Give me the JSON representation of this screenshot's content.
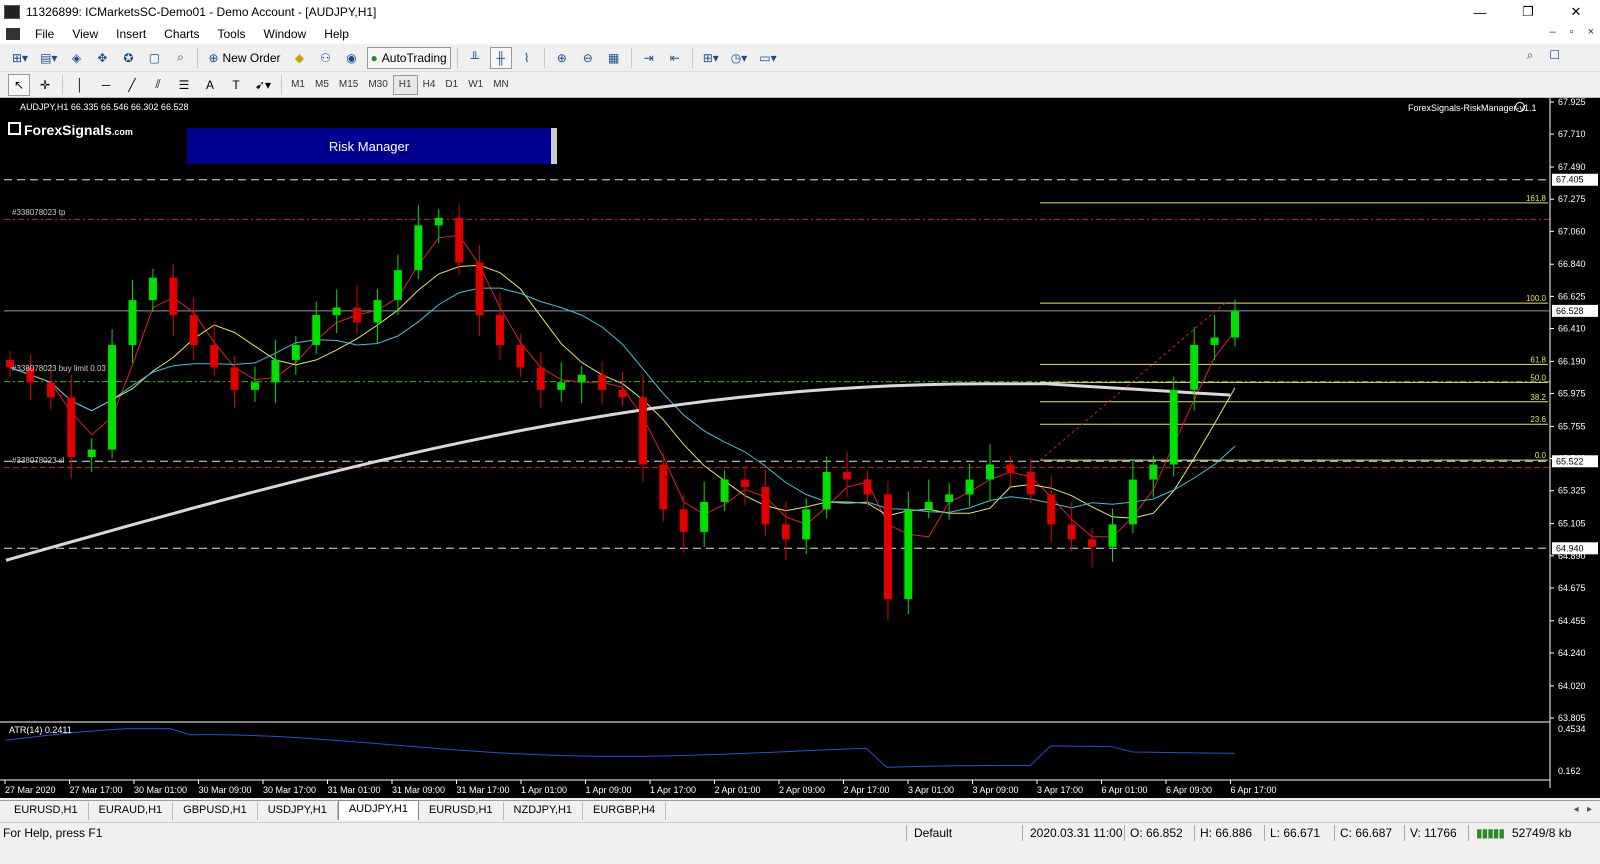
{
  "window": {
    "title": "11326899: ICMarketsSC-Demo01 - Demo Account - [AUDJPY,H1]",
    "controls": [
      "—",
      "❐",
      "✕"
    ]
  },
  "menu": {
    "items": [
      "File",
      "View",
      "Insert",
      "Charts",
      "Tools",
      "Window",
      "Help"
    ],
    "doc_controls": [
      "–",
      "▫",
      "×"
    ]
  },
  "toolbar": {
    "new_order": "New Order",
    "autotrading": "AutoTrading",
    "timeframes": [
      "M1",
      "M5",
      "M15",
      "M30",
      "H1",
      "H4",
      "D1",
      "W1",
      "MN"
    ],
    "active_timeframe": "H1"
  },
  "chart": {
    "header": "AUDJPY,H1  66.335 66.546 66.302 66.528",
    "logo": "ForexSignals",
    "logo_suffix": ".com",
    "risk_button": "Risk Manager",
    "indicator_label": "ForexSignals-RiskManager-v1.1",
    "tp_label": "#338078023 tp",
    "buy_label": "#338078023 buy limit 0.03",
    "sl_label": "#338078023 sl",
    "price_ticks": [
      "67.925",
      "67.710",
      "67.490",
      "67.275",
      "67.060",
      "66.840",
      "66.625",
      "66.410",
      "66.190",
      "65.975",
      "65.755",
      "65.540",
      "65.325",
      "65.105",
      "64.890",
      "64.675",
      "64.455",
      "64.240",
      "64.020",
      "63.805"
    ],
    "price_tags": [
      {
        "label": "67.405",
        "price": 67.405
      },
      {
        "label": "66.528",
        "price": 66.528
      },
      {
        "label": "65.522",
        "price": 65.522
      },
      {
        "label": "64.940",
        "price": 64.94
      }
    ],
    "fib_levels": [
      {
        "label": "161.8",
        "price": 67.25
      },
      {
        "label": "100.0",
        "price": 66.58
      },
      {
        "label": "61.8",
        "price": 66.17
      },
      {
        "label": "50.0",
        "price": 66.05
      },
      {
        "label": "38.2",
        "price": 65.92
      },
      {
        "label": "23.6",
        "price": 65.77
      },
      {
        "label": "0.0",
        "price": 65.53
      }
    ],
    "time_labels": [
      "27 Mar 2020",
      "27 Mar 17:00",
      "30 Mar 01:00",
      "30 Mar 09:00",
      "30 Mar 17:00",
      "31 Mar 01:00",
      "31 Mar 09:00",
      "31 Mar 17:00",
      "1 Apr 01:00",
      "1 Apr 09:00",
      "1 Apr 17:00",
      "2 Apr 01:00",
      "2 Apr 09:00",
      "2 Apr 17:00",
      "3 Apr 01:00",
      "3 Apr 09:00",
      "3 Apr 17:00",
      "6 Apr 01:00",
      "6 Apr 09:00",
      "6 Apr 17:00"
    ],
    "atr_label": "ATR(14) 0.2411",
    "atr_ticks": [
      "0.4534",
      "0.162"
    ]
  },
  "tabs": [
    "EURUSD,H1",
    "EURAUD,H1",
    "GBPUSD,H1",
    "USDJPY,H1",
    "AUDJPY,H1",
    "EURUSD,H1",
    "NZDJPY,H1",
    "EURGBP,H4"
  ],
  "active_tab": "AUDJPY,H1",
  "status": {
    "help": "For Help, press F1",
    "profile": "Default",
    "datetime": "2020.03.31 11:00",
    "open": "O: 66.852",
    "high": "H: 66.886",
    "low": "L: 66.671",
    "close": "C: 66.687",
    "volume": "V: 11766",
    "traffic": "52749/8 kb"
  },
  "colors": {
    "bull": "#00e000",
    "bear": "#e00000",
    "background": "#000000",
    "fib": "#ffff66",
    "risk_button": "#000090"
  },
  "chart_data": {
    "type": "candlestick",
    "symbol": "AUDJPY",
    "timeframe": "H1",
    "ylim": [
      63.805,
      67.925
    ],
    "series": [
      {
        "name": "close",
        "values": [
          66.15,
          66.05,
          65.95,
          65.55,
          65.6,
          66.3,
          66.6,
          66.75,
          66.5,
          66.3,
          66.15,
          66.0,
          66.05,
          66.2,
          66.3,
          66.5,
          66.55,
          66.45,
          66.6,
          66.8,
          67.1,
          67.15,
          66.85,
          66.5,
          66.3,
          66.15,
          66.0,
          66.05,
          66.1,
          66.0,
          65.95,
          65.5,
          65.2,
          65.05,
          65.25,
          65.4,
          65.35,
          65.1,
          65.0,
          65.2,
          65.45,
          65.4,
          65.3,
          64.6,
          65.2,
          65.25,
          65.3,
          65.4,
          65.5,
          65.45,
          65.3,
          65.1,
          65.0,
          64.95,
          65.1,
          65.4,
          65.5,
          66.0,
          66.3,
          66.35,
          66.53
        ]
      }
    ]
  }
}
